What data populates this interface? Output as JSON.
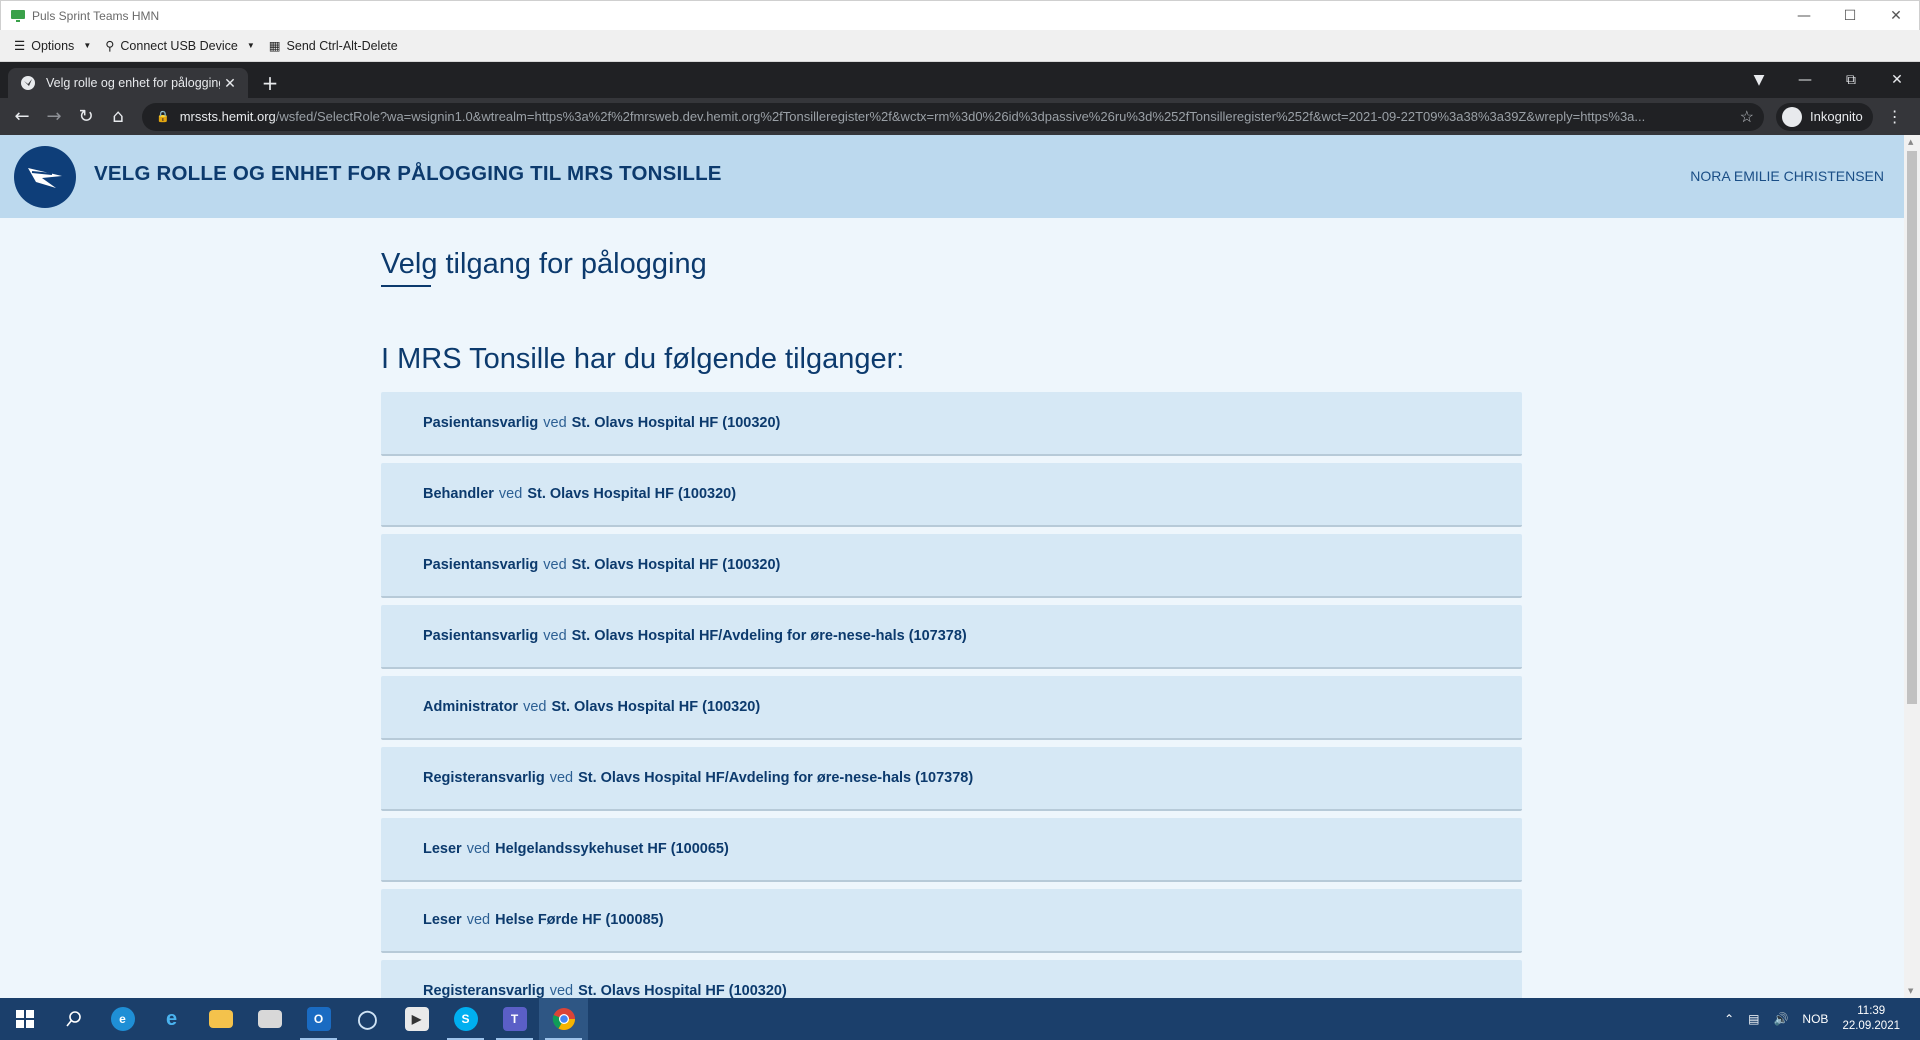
{
  "vdi": {
    "title": "Puls Sprint Teams HMN",
    "toolbar": {
      "options_label": "Options",
      "usb_label": "Connect USB Device",
      "cad_label": "Send Ctrl-Alt-Delete"
    }
  },
  "browser": {
    "tab_title": "Velg rolle og enhet for pålogging",
    "url_host": "mrssts.hemit.org",
    "url_path": "/wsfed/SelectRole?wa=wsignin1.0&wtrealm=https%3a%2f%2fmrsweb.dev.hemit.org%2fTonsilleregister%2f&wctx=rm%3d0%26id%3dpassive%26ru%3d%252fTonsilleregister%252f&wct=2021-09-22T09%3a38%3a39Z&wreply=https%3a...",
    "incognito_label": "Inkognito"
  },
  "site": {
    "header_title": "VELG ROLLE OG ENHET FOR PÅLOGGING TIL MRS TONSILLE",
    "user_name": "NORA EMILIE CHRISTENSEN",
    "page_heading": "Velg tilgang for pålogging",
    "section_heading": "I MRS Tonsille har du følgende tilganger:",
    "ved": "ved",
    "roles": [
      {
        "role": "Pasientansvarlig",
        "unit": "St. Olavs Hospital HF (100320)"
      },
      {
        "role": "Behandler",
        "unit": "St. Olavs Hospital HF (100320)"
      },
      {
        "role": "Pasientansvarlig",
        "unit": "St. Olavs Hospital HF (100320)"
      },
      {
        "role": "Pasientansvarlig",
        "unit": "St. Olavs Hospital HF/Avdeling for øre-nese-hals (107378)"
      },
      {
        "role": "Administrator",
        "unit": "St. Olavs Hospital HF (100320)"
      },
      {
        "role": "Registeransvarlig",
        "unit": "St. Olavs Hospital HF/Avdeling for øre-nese-hals (107378)"
      },
      {
        "role": "Leser",
        "unit": "Helgelandssykehuset HF (100065)"
      },
      {
        "role": "Leser",
        "unit": "Helse Førde HF (100085)"
      },
      {
        "role": "Registeransvarlig",
        "unit": "St. Olavs Hospital HF (100320)"
      }
    ]
  },
  "taskbar": {
    "language": "NOB",
    "time": "11:39",
    "date": "22.09.2021"
  },
  "colors": {
    "header_bg": "#bcd9ee",
    "page_bg": "#eef6fc",
    "role_bg": "#d6e8f5",
    "text_primary": "#0c3a6d",
    "taskbar_bg": "#1b3f6b"
  }
}
